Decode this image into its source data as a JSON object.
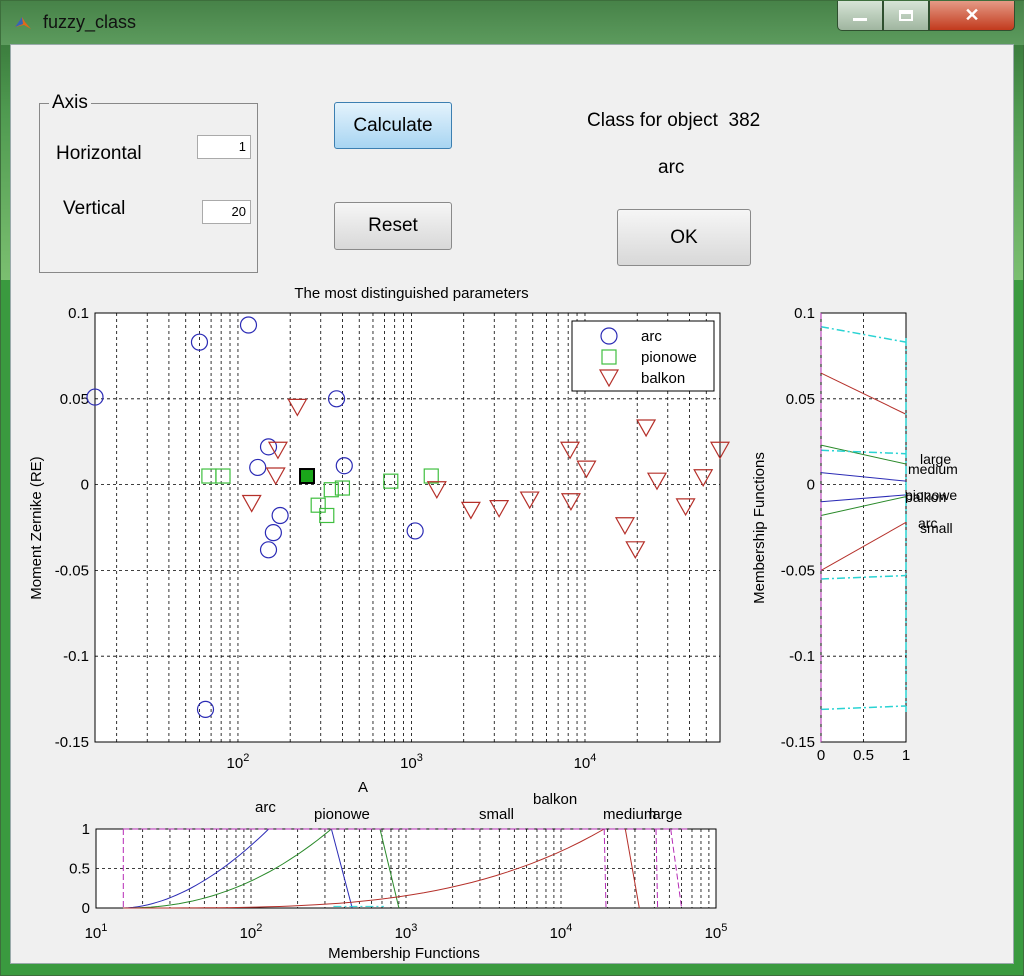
{
  "window": {
    "title": "fuzzy_class",
    "min_icon": "minimize-icon",
    "max_icon": "maximize-icon",
    "close_icon": "close-icon"
  },
  "axis_group": {
    "legend": "Axis",
    "horizontal_label": "Horizontal",
    "horizontal_value": "1",
    "vertical_label": "Vertical",
    "vertical_value": "20"
  },
  "buttons": {
    "calculate": "Calculate",
    "reset": "Reset",
    "ok": "OK"
  },
  "result": {
    "class_label": "Class for object  382",
    "class_value": "arc"
  },
  "colors": {
    "arc": "#2b2bb5",
    "pionowe": "#3fbf3f",
    "balkon": "#b5302a",
    "medium": "#b52ab5",
    "large": "#2ad3d3"
  },
  "chart_data": [
    {
      "type": "scatter",
      "title": "The most distinguished parameters",
      "xlabel": "A",
      "ylabel": "Moment Zernike (RE)",
      "xscale": "log",
      "xlim": [
        15,
        60000
      ],
      "ylim": [
        -0.15,
        0.1
      ],
      "xticks": [
        "10^2",
        "10^3",
        "10^4"
      ],
      "yticks": [
        "0.1",
        "0.05",
        "0",
        "-0.05",
        "-0.1",
        "-0.15"
      ],
      "grid": true,
      "legend_position": "top-right",
      "series": [
        {
          "name": "arc",
          "marker": "circle",
          "points": [
            [
              15,
              0.051
            ],
            [
              60,
              0.083
            ],
            [
              115,
              0.093
            ],
            [
              65,
              -0.131
            ],
            [
              130,
              0.01
            ],
            [
              150,
              0.022
            ],
            [
              160,
              -0.028
            ],
            [
              150,
              -0.038
            ],
            [
              175,
              -0.018
            ],
            [
              370,
              0.05
            ],
            [
              410,
              0.011
            ],
            [
              1050,
              -0.027
            ]
          ]
        },
        {
          "name": "pionowe",
          "marker": "square",
          "points": [
            [
              68,
              0.005
            ],
            [
              82,
              0.005
            ],
            [
              290,
              -0.012
            ],
            [
              325,
              -0.018
            ],
            [
              345,
              -0.003
            ],
            [
              400,
              -0.002
            ],
            [
              760,
              0.002
            ],
            [
              1300,
              0.005
            ]
          ]
        },
        {
          "name": "balkon",
          "marker": "triangle-down",
          "points": [
            [
              220,
              0.045
            ],
            [
              170,
              0.02
            ],
            [
              165,
              0.005
            ],
            [
              120,
              -0.011
            ],
            [
              1400,
              -0.003
            ],
            [
              2200,
              -0.015
            ],
            [
              3200,
              -0.014
            ],
            [
              4800,
              -0.009
            ],
            [
              8200,
              0.02
            ],
            [
              8300,
              -0.01
            ],
            [
              10200,
              0.009
            ],
            [
              17000,
              -0.024
            ],
            [
              19500,
              -0.038
            ],
            [
              22500,
              0.033
            ],
            [
              26000,
              0.002
            ],
            [
              38000,
              -0.013
            ],
            [
              48000,
              0.004
            ],
            [
              60000,
              0.02
            ]
          ]
        }
      ],
      "selected_point": {
        "x": 250,
        "y": 0.005,
        "label": "object 382"
      }
    },
    {
      "type": "line",
      "xlabel": "",
      "ylabel": "Membership Functions",
      "xlim": [
        0,
        1
      ],
      "ylim": [
        -0.15,
        0.1
      ],
      "xticks": [
        "0",
        "0.5",
        "1"
      ],
      "yticks": [
        "0.1",
        "0.05",
        "0",
        "-0.05",
        "-0.1",
        "-0.15"
      ],
      "labels": [
        "large",
        "medium",
        "pionowe",
        "balkon",
        "arc",
        "small"
      ]
    },
    {
      "type": "line",
      "xlabel": "Membership Functions",
      "xscale": "log",
      "xlim": [
        10,
        100000
      ],
      "ylim": [
        0,
        1
      ],
      "xticks": [
        "10^1",
        "10^2",
        "10^3",
        "10^4",
        "10^5"
      ],
      "yticks": [
        "1",
        "0.5",
        "0"
      ],
      "labels": [
        "arc",
        "pionowe",
        "small",
        "balkon",
        "medium",
        "large"
      ]
    }
  ]
}
